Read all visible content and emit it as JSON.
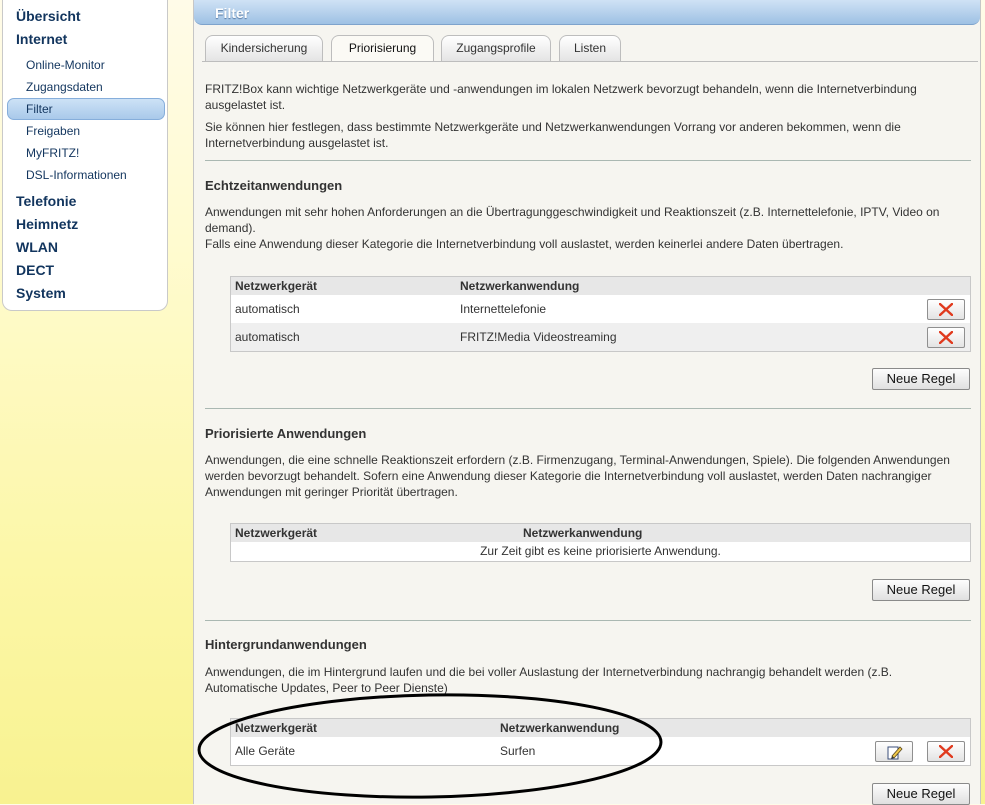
{
  "sidebar": {
    "items": [
      {
        "label": "Übersicht",
        "level": 0
      },
      {
        "label": "Internet",
        "level": 0
      },
      {
        "label": "Online-Monitor",
        "level": 1
      },
      {
        "label": "Zugangsdaten",
        "level": 1
      },
      {
        "label": "Filter",
        "level": 1,
        "active": true
      },
      {
        "label": "Freigaben",
        "level": 1
      },
      {
        "label": "MyFRITZ!",
        "level": 1
      },
      {
        "label": "DSL-Informationen",
        "level": 1
      },
      {
        "label": "Telefonie",
        "level": 0
      },
      {
        "label": "Heimnetz",
        "level": 0
      },
      {
        "label": "WLAN",
        "level": 0
      },
      {
        "label": "DECT",
        "level": 0
      },
      {
        "label": "System",
        "level": 0
      }
    ]
  },
  "header": {
    "title": "Filter"
  },
  "tabs": [
    {
      "label": "Kindersicherung"
    },
    {
      "label": "Priorisierung",
      "active": true
    },
    {
      "label": "Zugangsprofile"
    },
    {
      "label": "Listen"
    }
  ],
  "intro": {
    "p1": "FRITZ!Box kann wichtige Netzwerkgeräte und -anwendungen im lokalen Netzwerk bevorzugt behandeln, wenn die Internetverbindung ausgelastet ist.",
    "p2": "Sie können hier festlegen, dass bestimmte Netzwerkgeräte und Netzwerkanwendungen Vorrang vor anderen bekommen, wenn die Internetverbindung ausgelastet ist."
  },
  "sections": {
    "realtime": {
      "title": "Echtzeitanwendungen",
      "desc1": "Anwendungen mit sehr hohen Anforderungen an die Übertragunggeschwindigkeit und Reaktionszeit (z.B. Internettelefonie, IPTV, Video on demand).",
      "desc2": "Falls eine Anwendung dieser Kategorie die Internetverbindung voll auslastet, werden keinerlei andere Daten übertragen.",
      "col_device": "Netzwerkgerät",
      "col_app": "Netzwerkanwendung",
      "rows": [
        {
          "device": "automatisch",
          "app": "Internettelefonie"
        },
        {
          "device": "automatisch",
          "app": "FRITZ!Media Videostreaming"
        }
      ],
      "new_rule": "Neue Regel"
    },
    "prioritized": {
      "title": "Priorisierte Anwendungen",
      "desc": "Anwendungen, die eine schnelle Reaktionszeit erfordern (z.B. Firmenzugang, Terminal-Anwendungen, Spiele). Die folgenden Anwendungen werden bevorzugt behandelt. Sofern eine Anwendung dieser Kategorie die Internetverbindung voll auslastet, werden Daten nachrangiger Anwendungen mit geringer Priorität übertragen.",
      "col_device": "Netzwerkgerät",
      "col_app": "Netzwerkanwendung",
      "empty": "Zur Zeit gibt es keine priorisierte Anwendung.",
      "new_rule": "Neue Regel"
    },
    "background": {
      "title": "Hintergrundanwendungen",
      "desc": "Anwendungen, die im Hintergrund laufen und die bei voller Auslastung der Internetverbindung nachrangig behandelt werden (z.B. Automatische Updates, Peer to Peer Dienste)",
      "col_device": "Netzwerkgerät",
      "col_app": "Netzwerkanwendung",
      "rows": [
        {
          "device": "Alle Geräte",
          "app": "Surfen"
        }
      ],
      "new_rule": "Neue Regel"
    }
  },
  "colors": {
    "accent": "#12355e",
    "delete_icon": "#e03a1e",
    "annotation": "#000000"
  }
}
